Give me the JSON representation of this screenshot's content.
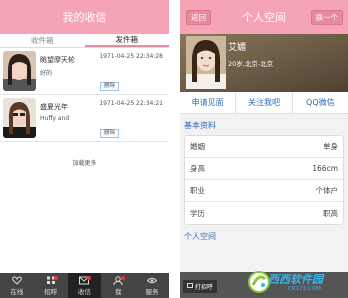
{
  "left": {
    "header_title": "我的收信",
    "tabs": [
      {
        "label": "收件箱",
        "active": false
      },
      {
        "label": "发件箱",
        "active": true
      }
    ],
    "messages": [
      {
        "name": "眺望摩天轮",
        "time": "1971-04-25 22:34:28",
        "text": "好的",
        "delete_label": "删除"
      },
      {
        "name": "盛夏光年",
        "time": "1971-04-25 22:34:21",
        "text": "Huffy and",
        "delete_label": "删除"
      }
    ],
    "load_more": "加载更多",
    "bottom_nav": [
      {
        "label": "在线",
        "icon": "heart-icon",
        "active": false,
        "badge": false
      },
      {
        "label": "招呼",
        "icon": "grid-icon",
        "active": false,
        "badge": true
      },
      {
        "label": "收信",
        "icon": "mail-icon",
        "active": true,
        "badge": true
      },
      {
        "label": "我",
        "icon": "person-icon",
        "active": false,
        "badge": true
      },
      {
        "label": "服务",
        "icon": "eye-icon",
        "active": false,
        "badge": false
      }
    ]
  },
  "right": {
    "header_title": "个人空间",
    "back_label": "返回",
    "switch_label": "换一个",
    "profile": {
      "name": "艾媚",
      "info": "20岁,北京-北京"
    },
    "actions": [
      "申请见面",
      "关注我吧",
      "QQ微信"
    ],
    "basic_title": "基本资料",
    "basic_rows": [
      {
        "label": "婚姻",
        "value": "单身"
      },
      {
        "label": "身高",
        "value": "166cm"
      },
      {
        "label": "职业",
        "value": "个体户"
      },
      {
        "label": "学历",
        "value": "职高"
      }
    ],
    "space_title": "个人空间",
    "call_label": "打招呼"
  },
  "watermark": {
    "text": "西西软件园",
    "url": "CR173.COM"
  },
  "colors": {
    "header": "#f4a4b4",
    "accent_blue": "#2e6db4",
    "nav_bg": "#444444"
  }
}
